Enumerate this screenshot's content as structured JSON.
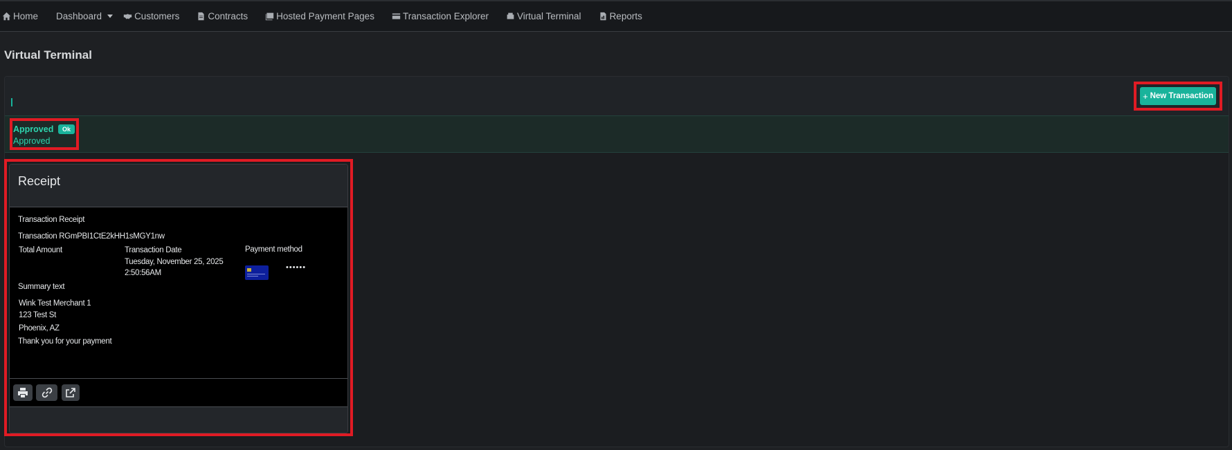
{
  "nav": {
    "items": [
      {
        "label": "Home",
        "icon": "home-icon"
      },
      {
        "label": "Dashboard",
        "icon": "none"
      },
      {
        "label": "Customers",
        "icon": "handshake-icon"
      },
      {
        "label": "Contracts",
        "icon": "document-icon"
      },
      {
        "label": "Hosted Payment Pages",
        "icon": "pages-icon"
      },
      {
        "label": "Transaction Explorer",
        "icon": "card-icon"
      },
      {
        "label": "Virtual Terminal",
        "icon": "terminal-icon"
      },
      {
        "label": "Reports",
        "icon": "report-icon"
      }
    ]
  },
  "page": {
    "title": "Virtual Terminal"
  },
  "toolbar": {
    "new_transaction_label": "New Transaction"
  },
  "alert": {
    "title": "Approved",
    "badge": "Ok",
    "message": "Approved",
    "color": "#2ed3ad"
  },
  "receipt": {
    "header": "Receipt",
    "heading": "Transaction Receipt",
    "transaction_line": "Transaction RGmPBI1CtE2kHH1sMGY1nw",
    "total_amount_label": "Total Amount",
    "transaction_date_label": "Transaction Date",
    "transaction_date_value": "Tuesday, November 25, 2025",
    "transaction_time_value": "2:50:56AM",
    "payment_method_label": "Payment method",
    "masked_number": "••••••",
    "summary_label": "Summary text",
    "merchant_name": "Wink Test Merchant 1",
    "merchant_street": "123 Test St",
    "merchant_city": "Phoenix, AZ",
    "thank_you": "Thank you for your payment",
    "actions": [
      "print-icon",
      "link-icon",
      "external-link-icon"
    ]
  },
  "colors": {
    "accent": "#19b39b",
    "highlight": "#e01b24",
    "background": "#1e2023"
  }
}
